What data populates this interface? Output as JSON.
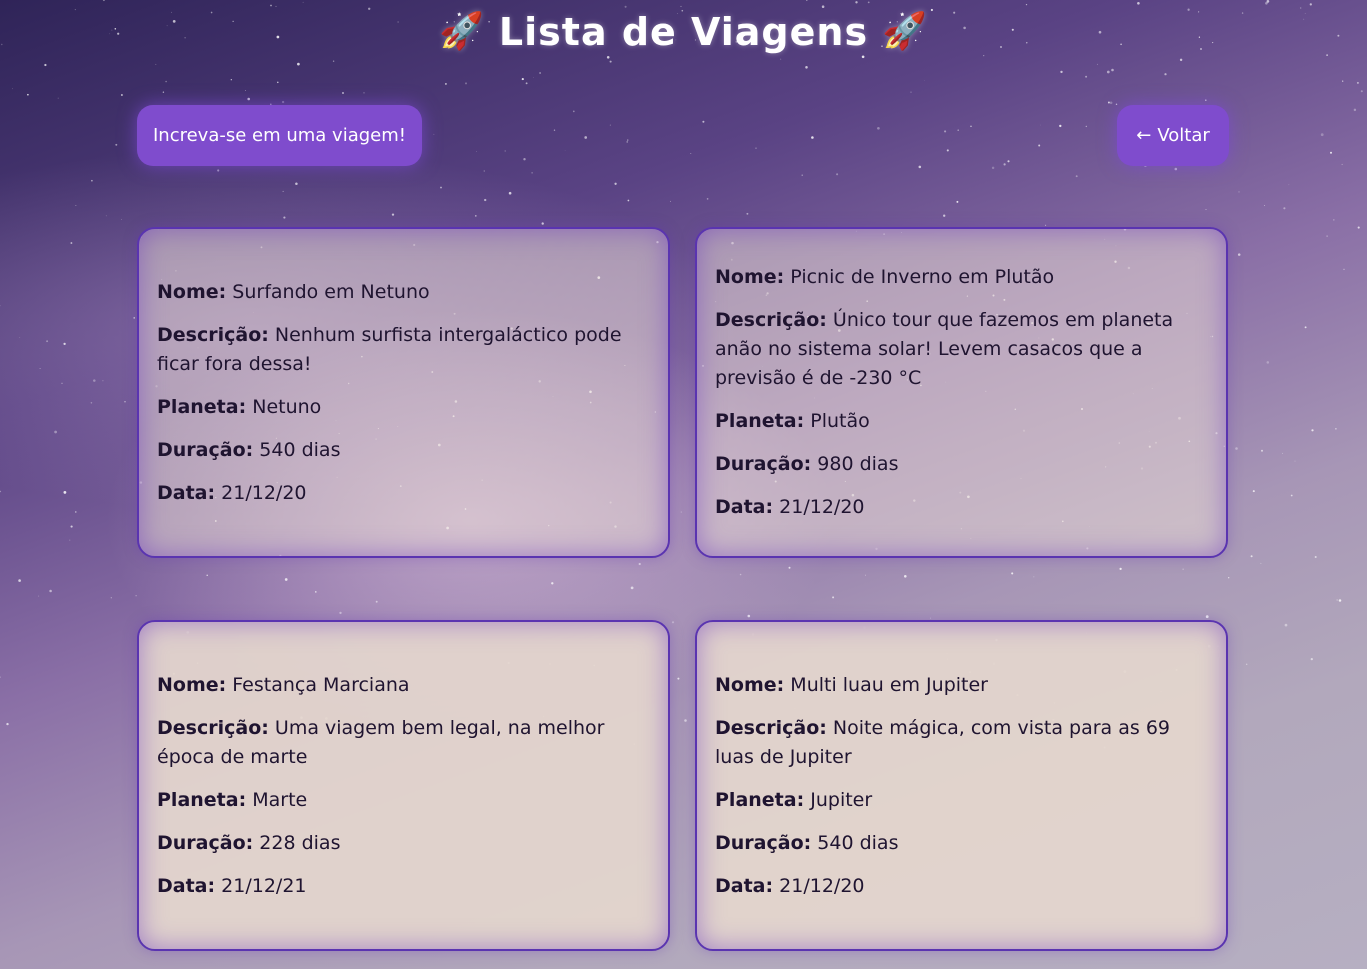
{
  "header": {
    "title": "Lista de Viagens",
    "icon": "rocket-icon"
  },
  "actions": {
    "subscribe_label": "Increva-se em uma viagem!",
    "back_arrow": "←",
    "back_label": "Voltar"
  },
  "labels": {
    "name": "Nome:",
    "description": "Descrição:",
    "planet": "Planeta:",
    "duration": "Duração:",
    "date": "Data:"
  },
  "trips": [
    {
      "name": "Surfando em Netuno",
      "description": "Nenhum surfista intergaláctico pode ficar fora dessa!",
      "planet": "Netuno",
      "duration": "540 dias",
      "date": "21/12/20"
    },
    {
      "name": "Picnic de Inverno em Plutão",
      "description": "Único tour que fazemos em planeta anão no sistema solar! Levem casacos que a previsão é de -230 °C",
      "planet": "Plutão",
      "duration": "980 dias",
      "date": "21/12/20"
    },
    {
      "name": "Festança Marciana",
      "description": "Uma viagem bem legal, na melhor época de marte",
      "planet": "Marte",
      "duration": "228 dias",
      "date": "21/12/21"
    },
    {
      "name": "Multi luau em Jupiter",
      "description": "Noite mágica, com vista para as 69 luas de Jupiter",
      "planet": "Jupiter",
      "duration": "540 dias",
      "date": "21/12/20"
    }
  ],
  "colors": {
    "accent": "#7f4ccd",
    "card_border": "#5a34b0",
    "card_background": "#e4d6cd",
    "title_text": "#ffffff"
  }
}
